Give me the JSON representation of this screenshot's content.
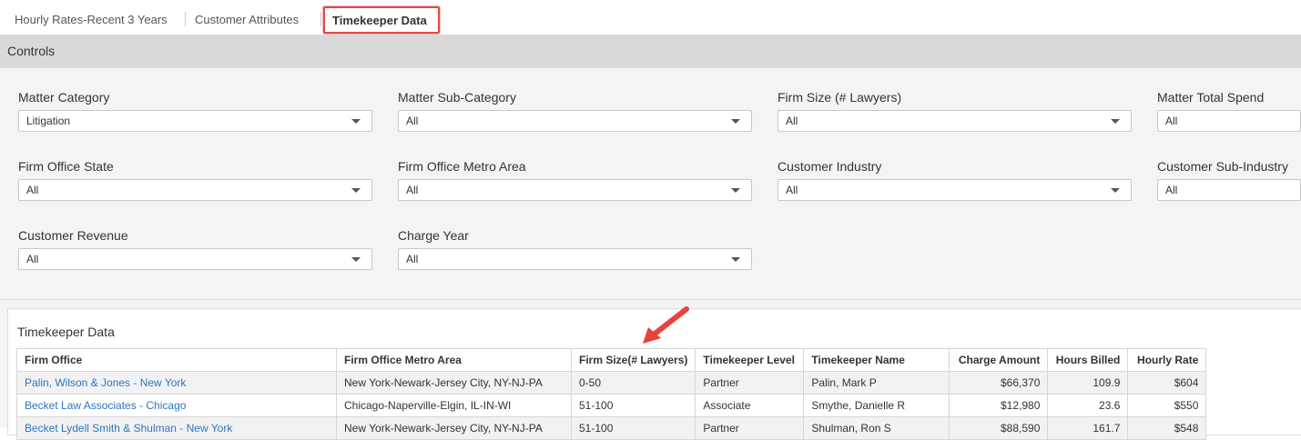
{
  "tabs": [
    {
      "label": "Hourly Rates-Recent 3 Years"
    },
    {
      "label": "Customer Attributes"
    },
    {
      "label": "Timekeeper Data"
    }
  ],
  "controls": {
    "header": "Controls",
    "filters": [
      {
        "label": "Matter Category",
        "value": "Litigation"
      },
      {
        "label": "Matter Sub-Category",
        "value": "All"
      },
      {
        "label": "Firm Size (# Lawyers)",
        "value": "All"
      },
      {
        "label": "Matter Total Spend",
        "value": "All"
      },
      {
        "label": "Firm Office State",
        "value": "All"
      },
      {
        "label": "Firm Office Metro Area",
        "value": "All"
      },
      {
        "label": "Customer Industry",
        "value": "All"
      },
      {
        "label": "Customer Sub-Industry",
        "value": "All"
      },
      {
        "label": "Customer Revenue",
        "value": "All"
      },
      {
        "label": "Charge Year",
        "value": "All"
      }
    ]
  },
  "timekeeper": {
    "title": "Timekeeper Data",
    "columns": [
      "Firm Office",
      "Firm Office Metro Area",
      "Firm Size(# Lawyers)",
      "Timekeeper Level",
      "Timekeeper Name",
      "Charge Amount",
      "Hours Billed",
      "Hourly Rate"
    ],
    "rows": [
      [
        "Palin, Wilson & Jones - New York",
        "New York-Newark-Jersey City, NY-NJ-PA",
        "0-50",
        "Partner",
        "Palin, Mark P",
        "$66,370",
        "109.9",
        "$604"
      ],
      [
        "Becket Law Associates - Chicago",
        "Chicago-Naperville-Elgin, IL-IN-WI",
        "51-100",
        "Associate",
        "Smythe, Danielle R",
        "$12,980",
        "23.6",
        "$550"
      ],
      [
        "Becket Lydell Smith & Shulman - New York",
        "New York-Newark-Jersey City, NY-NJ-PA",
        "51-100",
        "Partner",
        "Shulman, Ron S",
        "$88,590",
        "161.7",
        "$548"
      ]
    ]
  },
  "colors": {
    "tab_highlight": "#e04b4b",
    "link": "#2f74c0",
    "annotation_arrow": "#e8423f"
  }
}
